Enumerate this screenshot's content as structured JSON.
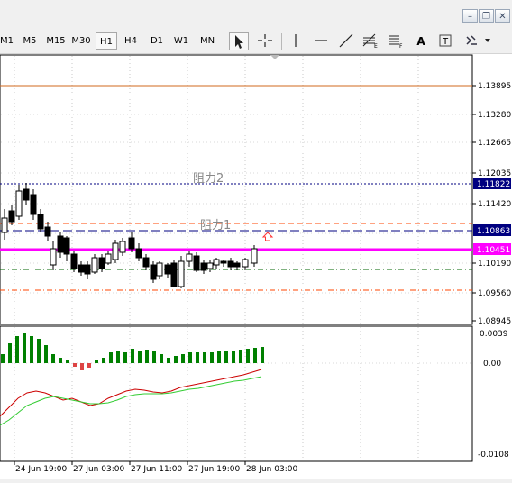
{
  "window": {
    "min_btn": "–",
    "restore_btn": "❐",
    "close_btn": "✕"
  },
  "toolbar": {
    "timeframes": [
      "M1",
      "M5",
      "M15",
      "M30",
      "H1",
      "H4",
      "D1",
      "W1",
      "MN"
    ],
    "active_timeframe": "H1",
    "tools": [
      "cursor-tool",
      "crosshair-tool",
      "vertical-line-tool",
      "horizontal-line-tool",
      "trendline-tool",
      "fibonacci-tool",
      "text-tool",
      "text-label-tool",
      "shapes-tool"
    ],
    "text_tool_label": "A",
    "text_label_tool_label": "T"
  },
  "price_axis": {
    "labels": [
      "1.13895",
      "1.13280",
      "1.12665",
      "1.12035",
      "1.11420",
      "1.10190",
      "1.09560",
      "1.08945"
    ],
    "tags": [
      {
        "text": "1.11822",
        "bg": "#000080",
        "fg": "#ffffff"
      },
      {
        "text": "1.10863",
        "bg": "#000080",
        "fg": "#ffffff"
      },
      {
        "text": "1.10451",
        "bg": "#ff00ff",
        "fg": "#ffffff"
      }
    ]
  },
  "chart_labels": {
    "resistance2": "阻力2",
    "resistance1": "阻力1"
  },
  "indicator_axis": {
    "labels": [
      "0.0039",
      "0.00",
      "-0.0108"
    ]
  },
  "time_axis": {
    "labels": [
      "24 Jun 19:00",
      "27 Jun 03:00",
      "27 Jun 11:00",
      "27 Jun 19:00",
      "28 Jun 03:00"
    ]
  },
  "colors": {
    "magenta_line": "#ff00ff",
    "navy": "#000080",
    "histogram_up": "#008000",
    "histogram_down": "#dd4444"
  }
}
